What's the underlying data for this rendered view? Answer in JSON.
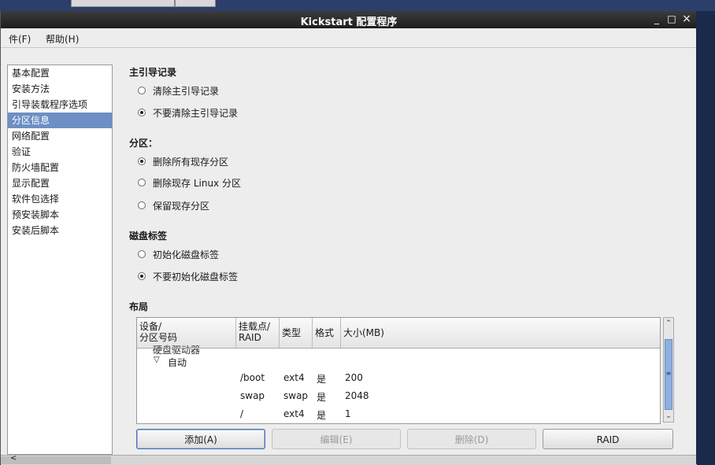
{
  "window": {
    "title": "Kickstart 配置程序"
  },
  "menubar": {
    "file": "件(F)",
    "help": "帮助(H)"
  },
  "window_controls": {
    "minimize": "_",
    "maximize": "□",
    "close": "×"
  },
  "sidebar": {
    "items": [
      {
        "label": "基本配置"
      },
      {
        "label": "安装方法"
      },
      {
        "label": "引导装载程序选项"
      },
      {
        "label": "分区信息",
        "selected": true
      },
      {
        "label": "网络配置"
      },
      {
        "label": "验证"
      },
      {
        "label": "防火墙配置"
      },
      {
        "label": "显示配置"
      },
      {
        "label": "软件包选择"
      },
      {
        "label": "预安装脚本"
      },
      {
        "label": "安装后脚本"
      }
    ]
  },
  "mbr": {
    "heading": "主引导记录",
    "options": [
      {
        "label": "清除主引导记录",
        "checked": false
      },
      {
        "label": "不要清除主引导记录",
        "checked": true
      }
    ]
  },
  "partitions": {
    "heading": "分区：",
    "options": [
      {
        "label": "删除所有现存分区",
        "checked": true
      },
      {
        "label": "删除现存 Linux 分区",
        "checked": false
      },
      {
        "label": "保留现存分区",
        "checked": false
      }
    ]
  },
  "disklabel": {
    "heading": "磁盘标签",
    "options": [
      {
        "label": "初始化磁盘标签",
        "checked": false
      },
      {
        "label": "不要初始化磁盘标签",
        "checked": true
      }
    ]
  },
  "layout": {
    "heading": "布局",
    "columns": [
      {
        "line1": "设备/",
        "line2": "分区号码"
      },
      {
        "line1": "挂载点/",
        "line2": "RAID"
      },
      {
        "line1": "类型",
        "line2": ""
      },
      {
        "line1": "格式",
        "line2": ""
      },
      {
        "line1": "大小(MB)",
        "line2": ""
      }
    ],
    "cut_row": "硬盘驱动器",
    "group_label": "自动",
    "group_expander": "▽",
    "rows": [
      {
        "mount": "/boot",
        "type": "ext4",
        "format": "是",
        "size": "200"
      },
      {
        "mount": "swap",
        "type": "swap",
        "format": "是",
        "size": "2048"
      },
      {
        "mount": "/",
        "type": "ext4",
        "format": "是",
        "size": "1"
      }
    ]
  },
  "buttons": {
    "add": "添加(A)",
    "edit": "编辑(E)",
    "delete": "删除(D)",
    "raid": "RAID"
  },
  "scroll_glyphs": {
    "up": "⌃",
    "down": "⌄",
    "grip": "≡",
    "left": "<"
  }
}
